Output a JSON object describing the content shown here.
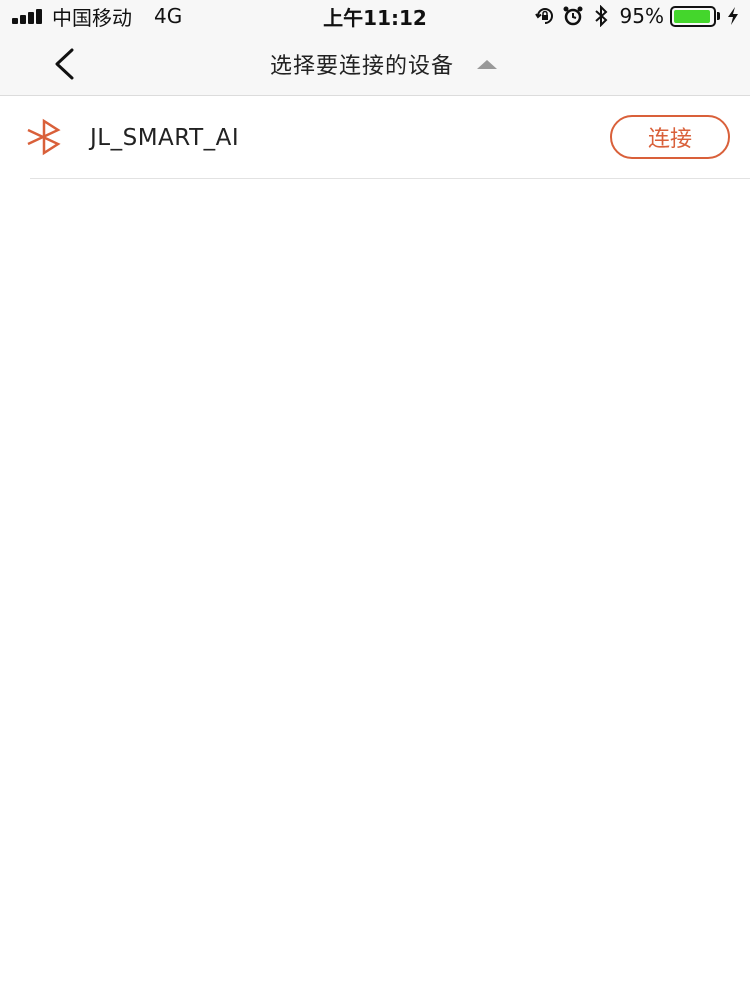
{
  "status_bar": {
    "carrier": "中国移动",
    "network": "4G",
    "time": "上午11:12",
    "battery_percent_text": "95%",
    "battery_level": 0.95,
    "icons": [
      "signal-icon",
      "rotation-lock-icon",
      "alarm-icon",
      "bluetooth-icon",
      "battery-icon",
      "charging-bolt-icon"
    ]
  },
  "nav": {
    "title": "选择要连接的设备",
    "back_icon": "chevron-left-icon",
    "caret_icon": "caret-up-icon"
  },
  "devices": [
    {
      "name": "JL_SMART_AI",
      "action_label": "连接",
      "icon": "bluetooth-icon"
    }
  ],
  "colors": {
    "accent": "#d9603a",
    "battery_green": "#44d62c",
    "bar_background": "#f7f7f7"
  }
}
